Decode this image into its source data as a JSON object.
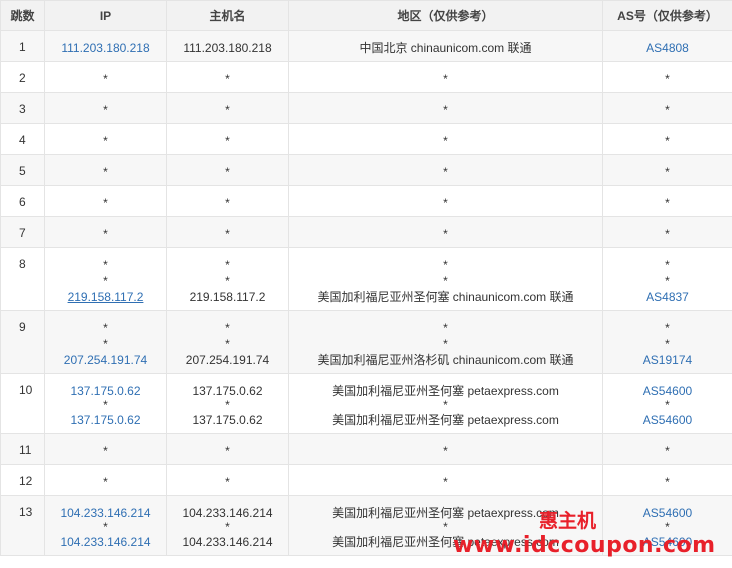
{
  "columns": [
    "跳数",
    "IP",
    "主机名",
    "地区（仅供参考）",
    "AS号（仅供参考）"
  ],
  "rows": [
    {
      "hop": "1",
      "lines": [
        {
          "ip": "111.203.180.218",
          "host": "111.203.180.218",
          "region": "中国北京 chinaunicom.com 联通",
          "as": "AS4808"
        }
      ]
    },
    {
      "hop": "2",
      "lines": [
        {
          "ip": "*",
          "host": "*",
          "region": "*",
          "as": "*"
        }
      ]
    },
    {
      "hop": "3",
      "lines": [
        {
          "ip": "*",
          "host": "*",
          "region": "*",
          "as": "*"
        }
      ]
    },
    {
      "hop": "4",
      "lines": [
        {
          "ip": "*",
          "host": "*",
          "region": "*",
          "as": "*"
        }
      ]
    },
    {
      "hop": "5",
      "lines": [
        {
          "ip": "*",
          "host": "*",
          "region": "*",
          "as": "*"
        }
      ]
    },
    {
      "hop": "6",
      "lines": [
        {
          "ip": "*",
          "host": "*",
          "region": "*",
          "as": "*"
        }
      ]
    },
    {
      "hop": "7",
      "lines": [
        {
          "ip": "*",
          "host": "*",
          "region": "*",
          "as": "*"
        }
      ]
    },
    {
      "hop": "8",
      "lines": [
        {
          "ip": "*",
          "host": "*",
          "region": "*",
          "as": "*"
        },
        {
          "ip": "*",
          "host": "*",
          "region": "*",
          "as": "*"
        },
        {
          "ip": "219.158.117.2",
          "host": "219.158.117.2",
          "region": "美国加利福尼亚州圣何塞 chinaunicom.com 联通",
          "as": "AS4837",
          "underline": true
        }
      ]
    },
    {
      "hop": "9",
      "lines": [
        {
          "ip": "*",
          "host": "*",
          "region": "*",
          "as": "*"
        },
        {
          "ip": "*",
          "host": "*",
          "region": "*",
          "as": "*"
        },
        {
          "ip": "207.254.191.74",
          "host": "207.254.191.74",
          "region": "美国加利福尼亚州洛杉矶 chinaunicom.com 联通",
          "as": "AS19174"
        }
      ]
    },
    {
      "hop": "10",
      "lines": [
        {
          "ip": "137.175.0.62",
          "host": "137.175.0.62",
          "region": "美国加利福尼亚州圣何塞 petaexpress.com",
          "as": "AS54600"
        },
        {
          "ip": "*",
          "host": "*",
          "region": "*",
          "as": "*",
          "short": true
        },
        {
          "ip": "137.175.0.62",
          "host": "137.175.0.62",
          "region": "美国加利福尼亚州圣何塞 petaexpress.com",
          "as": "AS54600"
        }
      ]
    },
    {
      "hop": "11",
      "lines": [
        {
          "ip": "*",
          "host": "*",
          "region": "*",
          "as": "*"
        }
      ]
    },
    {
      "hop": "12",
      "lines": [
        {
          "ip": "*",
          "host": "*",
          "region": "*",
          "as": "*"
        }
      ]
    },
    {
      "hop": "13",
      "lines": [
        {
          "ip": "104.233.146.214",
          "host": "104.233.146.214",
          "region": "美国加利福尼亚州圣何塞 petaexpress.com",
          "as": "AS54600"
        },
        {
          "ip": "*",
          "host": "*",
          "region": "*",
          "as": "*",
          "short": true
        },
        {
          "ip": "104.233.146.214",
          "host": "104.233.146.214",
          "region": "美国加利福尼亚州圣何塞 petaexpress.com",
          "as": "AS54600"
        }
      ]
    }
  ],
  "watermark": {
    "name": "惠主机",
    "url": "www.idccoupon.com"
  },
  "colors": {
    "link": "#2f6fb3",
    "watermark": "#e8202a",
    "header_bg": "#f2f2f2",
    "stripe_bg": "#f7f7f7"
  }
}
